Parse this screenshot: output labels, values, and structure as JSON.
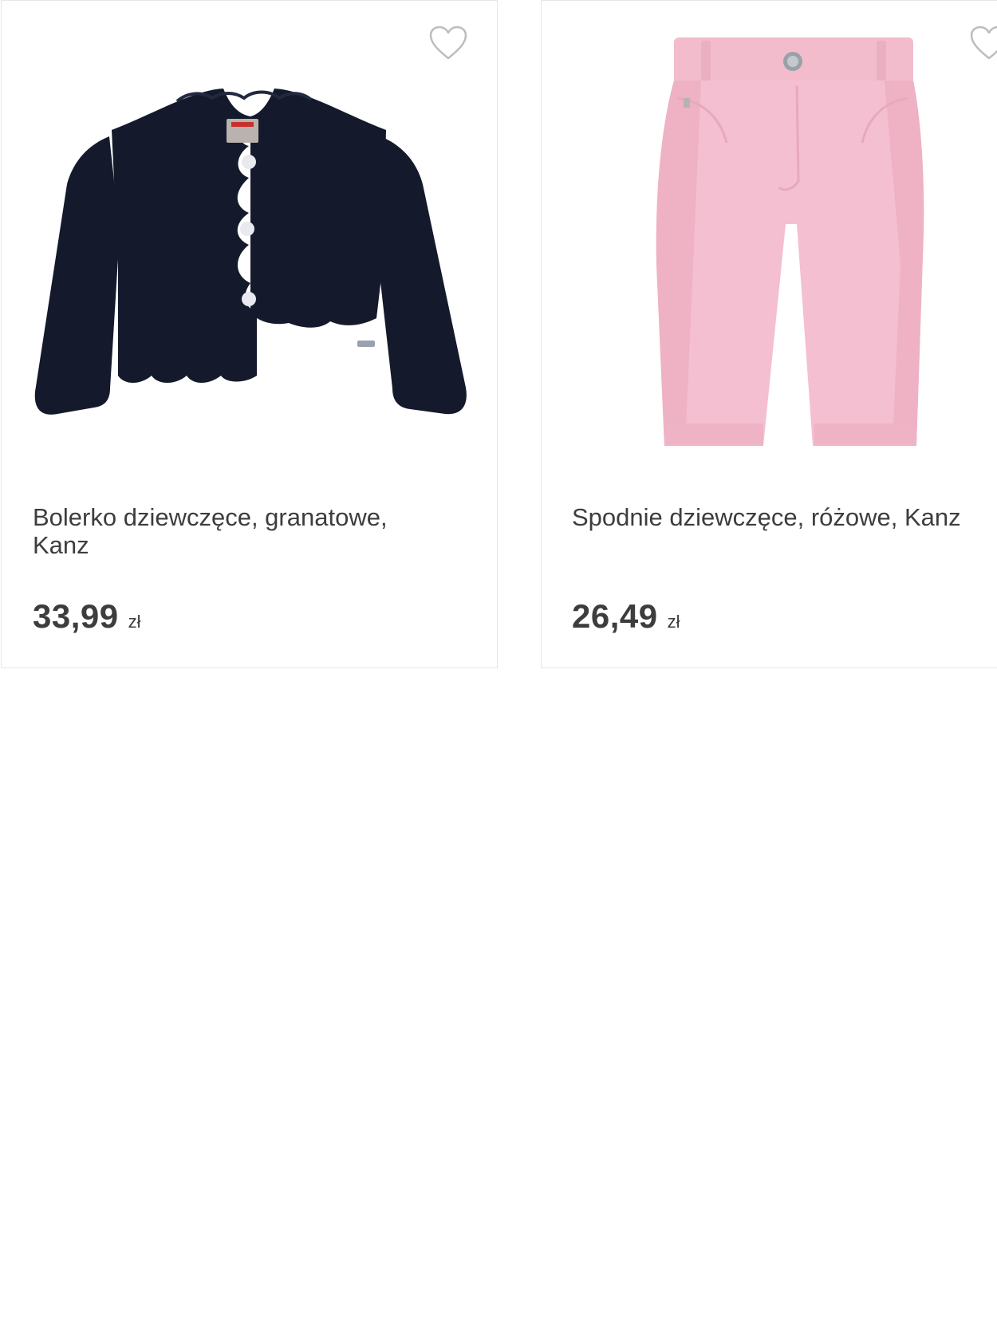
{
  "products": [
    {
      "name": "Bolerko dziewczęce, granatowe, Kanz",
      "price": "33,99",
      "currency": "zł",
      "image_icon": "navy-cardigan-image",
      "favorite_icon": "heart-outline-icon",
      "color": "#141a2c"
    },
    {
      "name": "Spodnie dziewczęce, różowe, Kanz",
      "price": "26,49",
      "currency": "zł",
      "image_icon": "pink-trousers-image",
      "favorite_icon": "heart-outline-icon",
      "color": "#f1b8cb"
    }
  ]
}
